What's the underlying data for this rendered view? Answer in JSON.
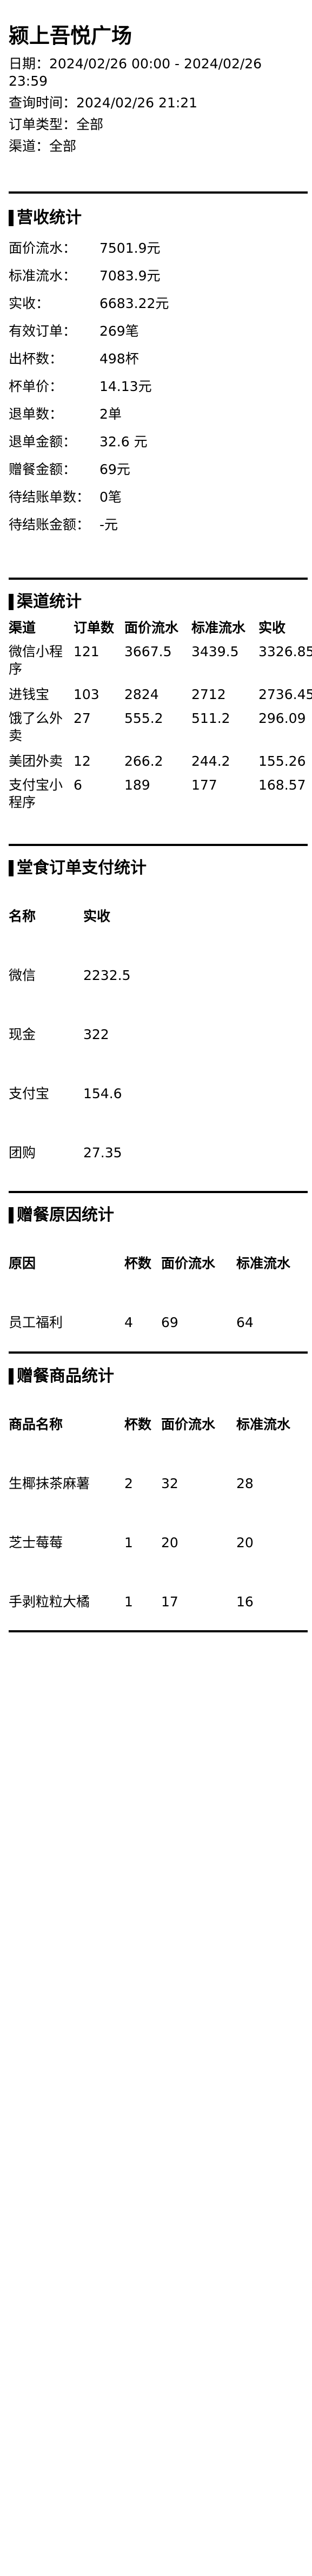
{
  "header": {
    "title": "颍上吾悦广场",
    "date_line": "日期：2024/02/26 00:00 - 2024/02/26 23:59",
    "query_time": "查询时间：2024/02/26 21:21",
    "order_type": "订单类型：全部",
    "channel": "渠道：全部"
  },
  "revenue": {
    "title": "营收统计",
    "rows": [
      {
        "k": "面价流水：",
        "v": "7501.9元"
      },
      {
        "k": "标准流水：",
        "v": "7083.9元"
      },
      {
        "k": "实收：",
        "v": "6683.22元"
      },
      {
        "k": "有效订单：",
        "v": "269笔"
      },
      {
        "k": "出杯数：",
        "v": "498杯"
      },
      {
        "k": "杯单价：",
        "v": "14.13元"
      },
      {
        "k": "退单数：",
        "v": "2单"
      },
      {
        "k": "退单金额：",
        "v": "32.6 元"
      },
      {
        "k": "赠餐金额：",
        "v": "69元"
      },
      {
        "k": "待结账单数：",
        "v": "0笔"
      },
      {
        "k": "待结账金额：",
        "v": "-元"
      }
    ]
  },
  "channels": {
    "title": "渠道统计",
    "headers": [
      "渠道",
      "订单数",
      "面价流水",
      "标准流水",
      "实收"
    ],
    "rows": [
      [
        "微信小程序",
        "121",
        "3667.5",
        "3439.5",
        "3326.85"
      ],
      [
        "进钱宝",
        "103",
        "2824",
        "2712",
        "2736.45"
      ],
      [
        "饿了么外卖",
        "27",
        "555.2",
        "511.2",
        "296.09"
      ],
      [
        "美团外卖",
        "12",
        "266.2",
        "244.2",
        "155.26"
      ],
      [
        "支付宝小程序",
        "6",
        "189",
        "177",
        "168.57"
      ]
    ]
  },
  "dine_payment": {
    "title": "堂食订单支付统计",
    "headers": [
      "名称",
      "实收"
    ],
    "rows": [
      [
        "微信",
        "2232.5"
      ],
      [
        "现金",
        "322"
      ],
      [
        "支付宝",
        "154.6"
      ],
      [
        "团购",
        "27.35"
      ]
    ]
  },
  "gift_reason": {
    "title": "赠餐原因统计",
    "headers": [
      "原因",
      "杯数",
      "面价流水",
      "标准流水"
    ],
    "rows": [
      [
        "员工福利",
        "4",
        "69",
        "64"
      ]
    ]
  },
  "gift_products": {
    "title": "赠餐商品统计",
    "headers": [
      "商品名称",
      "杯数",
      "面价流水",
      "标准流水"
    ],
    "rows": [
      [
        "生椰抹茶麻薯",
        "2",
        "32",
        "28"
      ],
      [
        "芝士莓莓",
        "1",
        "20",
        "20"
      ],
      [
        "手剥粒粒大橘",
        "1",
        "17",
        "16"
      ]
    ]
  }
}
